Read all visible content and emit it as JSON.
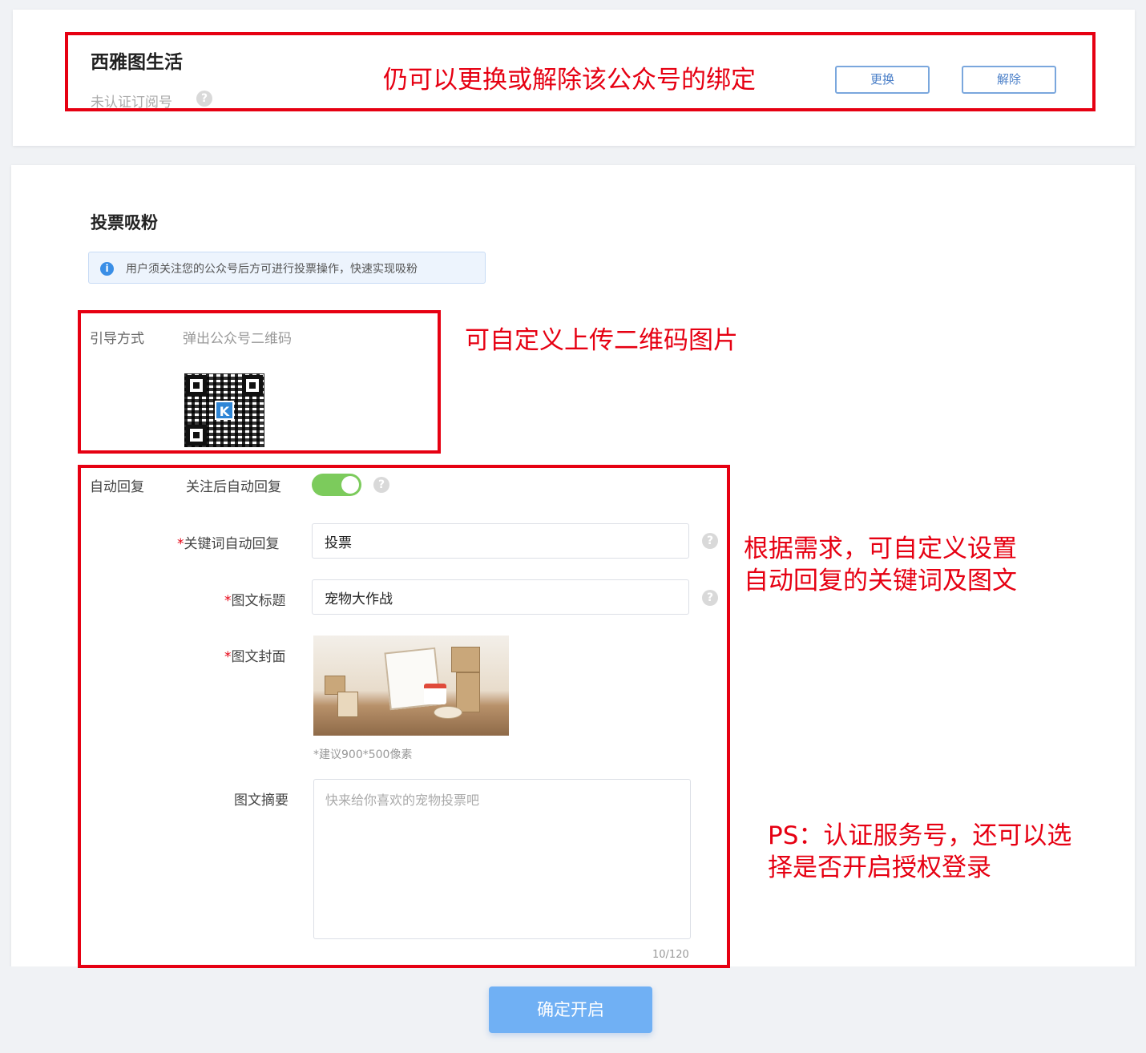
{
  "account": {
    "name": "西雅图生活",
    "type": "未认证订阅号",
    "replace_label": "更换",
    "unbind_label": "解除"
  },
  "vote": {
    "section_title": "投票吸粉",
    "notice": "用户须关注您的公众号后方可进行投票操作，快速实现吸粉",
    "guide_label": "引导方式",
    "guide_value": "弹出公众号二维码",
    "auto_reply_label": "自动回复",
    "follow_reply_label": "关注后自动回复",
    "follow_reply_enabled": true,
    "keyword_label": "关键词自动回复",
    "keyword_value": "投票",
    "title_label": "图文标题",
    "title_value": "宠物大作战",
    "cover_label": "图文封面",
    "cover_hint": "*建议900*500像素",
    "summary_label": "图文摘要",
    "summary_placeholder": "快来给你喜欢的宠物投票吧",
    "summary_count": "10/120",
    "required_mark": "*"
  },
  "footer": {
    "confirm_label": "确定开启"
  },
  "annotations": {
    "account": "仍可以更换或解除该公众号的绑定",
    "qrcode": "可自定义上传二维码图片",
    "reply_line1": "根据需求，可自定义设置",
    "reply_line2": "自动回复的关键词及图文",
    "ps_line1": "PS：认证服务号，还可以选",
    "ps_line2": "择是否开启授权登录"
  },
  "colors": {
    "annotation_red": "#e60012",
    "toggle_green": "#7ccb5c",
    "primary_blue": "#70b0f4",
    "info_blue": "#3a8ee6"
  },
  "icons": {
    "help": "question-circle-icon",
    "info": "info-circle-icon"
  }
}
